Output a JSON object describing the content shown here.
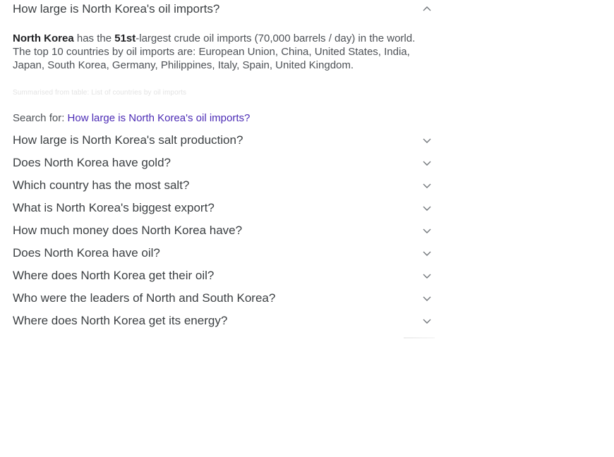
{
  "expanded": {
    "question": "How large is North Korea's oil imports?",
    "answer": {
      "subject": "North Korea",
      "part1": " has the ",
      "rank": "51st",
      "part2": "-largest crude oil imports (70,000 barrels / day) in the world. The top 10 countries by oil imports are: European Union, China, United States, India, Japan, South Korea, Germany, Philippines, Italy, Spain, United Kingdom."
    },
    "source": "Summarised from table: List of countries by oil imports",
    "search_for_label": "Search for: ",
    "search_for_link": "How large is North Korea's oil imports?"
  },
  "questions": [
    "How large is North Korea's salt production?",
    "Does North Korea have gold?",
    "Which country has the most salt?",
    "What is North Korea's biggest export?",
    "How much money does North Korea have?",
    "Does North Korea have oil?",
    "Where does North Korea get their oil?",
    "Who were the leaders of North and South Korea?",
    "Where does North Korea get its energy?"
  ],
  "icons": {
    "expanded": "chevron-up-icon",
    "collapsed": "chevron-down-icon"
  },
  "colors": {
    "link": "#4b2bb5",
    "question_text": "#3c4043",
    "answer_text": "#4d5156",
    "chevron": "#70757a"
  }
}
